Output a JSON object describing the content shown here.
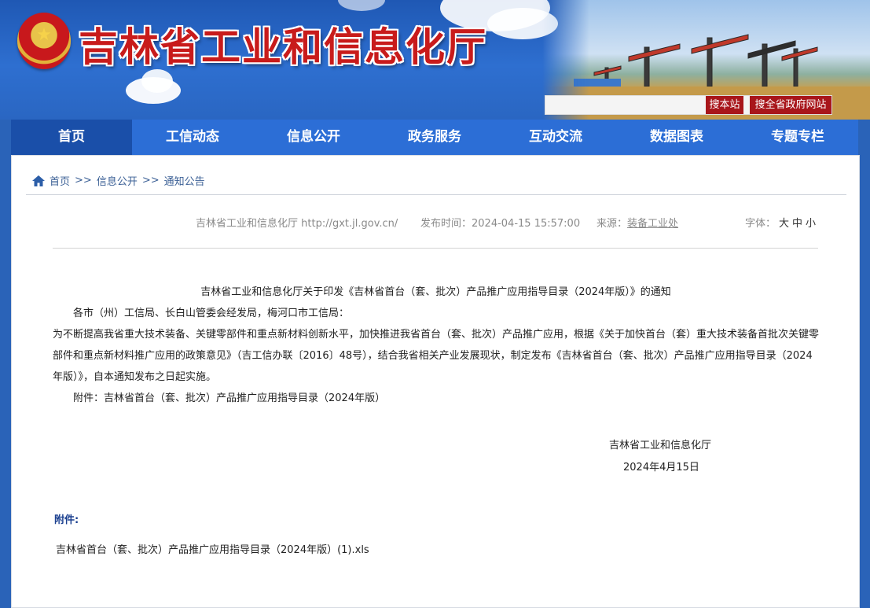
{
  "header": {
    "site_title": "吉林省工业和信息化厅",
    "search_placeholder": "",
    "search_site_label": "搜本站",
    "search_all_label": "搜全省政府网站"
  },
  "nav": {
    "items": [
      {
        "label": "首页",
        "active": true
      },
      {
        "label": "工信动态"
      },
      {
        "label": "信息公开"
      },
      {
        "label": "政务服务"
      },
      {
        "label": "互动交流"
      },
      {
        "label": "数据图表"
      },
      {
        "label": "专题专栏"
      }
    ]
  },
  "breadcrumb": {
    "home": "首页",
    "sep1": ">>",
    "level2": "信息公开",
    "sep2": ">>",
    "level3": "通知公告"
  },
  "meta": {
    "source_site": "吉林省工业和信息化厅 http://gxt.jl.gov.cn/",
    "publish_label": "发布时间：",
    "publish_time": "2024-04-15 15:57:00",
    "origin_label": "来源：",
    "origin_value": "装备工业处",
    "font_label": "字体：",
    "font_large": "大",
    "font_medium": "中",
    "font_small": "小"
  },
  "article": {
    "title": "吉林省工业和信息化厅关于印发《吉林省首台（套、批次）产品推广应用指导目录（2024年版）》的通知",
    "salutation": "各市（州）工信局、长白山管委会经发局，梅河口市工信局：",
    "body": "为不断提高我省重大技术装备、关键零部件和重点新材料创新水平，加快推进我省首台（套、批次）产品推广应用，根据《关于加快首台（套）重大技术装备首批次关键零部件和重点新材料推广应用的政策意见》（吉工信办联〔2016〕48号），结合我省相关产业发展现状，制定发布《吉林省首台（套、批次）产品推广应用指导目录（2024年版）》，自本通知发布之日起实施。",
    "attachment_line": "附件：吉林省首台（套、批次）产品推广应用指导目录（2024年版）",
    "signer": "吉林省工业和信息化厅",
    "date": "2024年4月15日"
  },
  "attachments": {
    "label": "附件:",
    "file_name": "吉林省首台（套、批次）产品推广应用指导目录（2024年版）(1).xls"
  },
  "colors": {
    "header_blue": "#2e6fd0",
    "nav_blue": "#2c6ed6",
    "nav_active": "#1a4fa9",
    "title_red": "#c81b1b",
    "button_red": "#a8161b"
  }
}
